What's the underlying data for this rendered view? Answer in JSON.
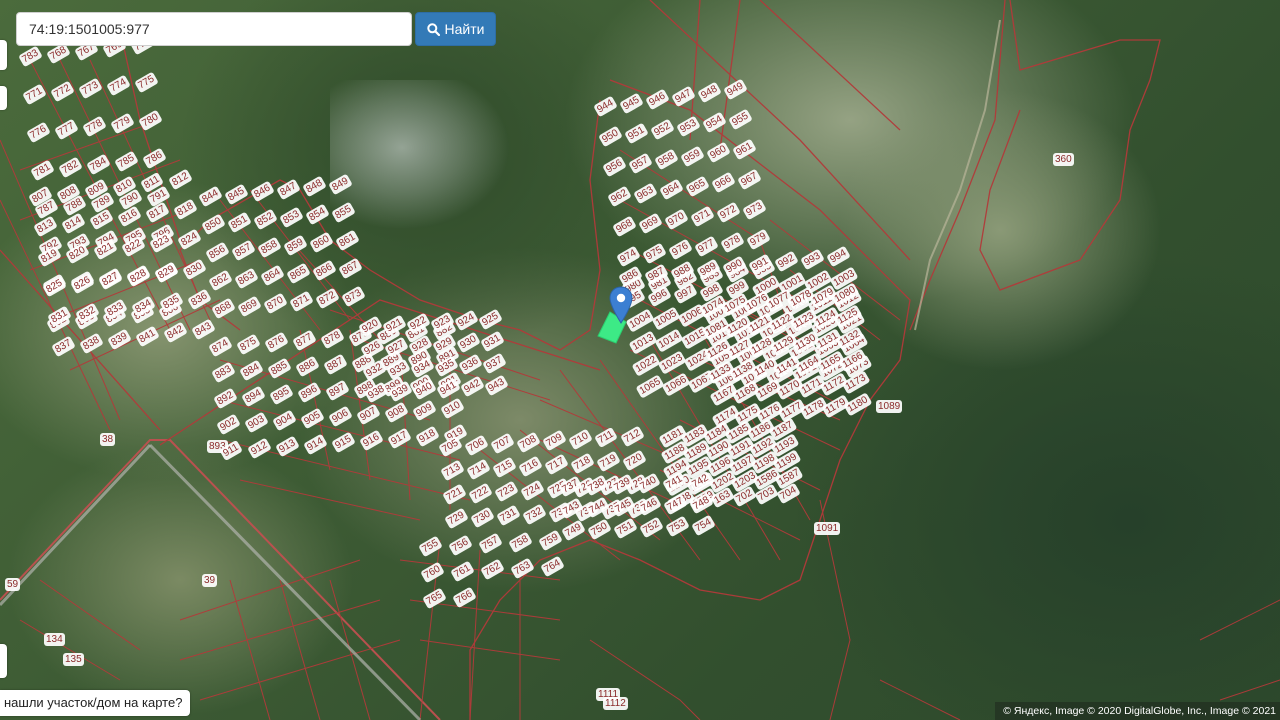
{
  "search": {
    "value": "74:19:1501005:977",
    "button_label": "Найти",
    "button_icon": "search-icon"
  },
  "feedback_tab": {
    "label": "нашли участок/дом на карте?"
  },
  "attribution": {
    "text": "© Яндекс, Image © 2020 DigitalGlobe, Inc., Image © 2021"
  },
  "marker": {
    "icon": "map-pin-icon",
    "color": "#3c7fd2"
  },
  "selected_parcel": {
    "color": "#3dea86"
  },
  "colors": {
    "parcel_border": "#b23a3a",
    "label_text": "#8b2a2a",
    "button": "#337ab7"
  },
  "parcel_labels": [
    "783",
    "768",
    "767",
    "769",
    "770",
    "771",
    "772",
    "773",
    "774",
    "775",
    "776",
    "777",
    "778",
    "779",
    "780",
    "781",
    "782",
    "784",
    "785",
    "786",
    "787",
    "788",
    "789",
    "790",
    "791",
    "792",
    "793",
    "794",
    "795",
    "796",
    "797",
    "798",
    "799",
    "800",
    "801",
    "802",
    "803",
    "804",
    "805",
    "806",
    "807",
    "808",
    "809",
    "810",
    "811",
    "812",
    "813",
    "814",
    "815",
    "816",
    "817",
    "818",
    "819",
    "820",
    "821",
    "822",
    "823",
    "824",
    "825",
    "826",
    "827",
    "828",
    "829",
    "830",
    "831",
    "832",
    "833",
    "834",
    "835",
    "836",
    "837",
    "838",
    "839",
    "841",
    "842",
    "843",
    "844",
    "845",
    "846",
    "847",
    "848",
    "849",
    "850",
    "851",
    "852",
    "853",
    "854",
    "855",
    "856",
    "857",
    "858",
    "859",
    "860",
    "861",
    "862",
    "863",
    "864",
    "865",
    "866",
    "867",
    "868",
    "869",
    "870",
    "871",
    "872",
    "873",
    "874",
    "875",
    "876",
    "877",
    "878",
    "879",
    "880",
    "881",
    "882",
    "883",
    "884",
    "885",
    "886",
    "887",
    "888",
    "889",
    "890",
    "891",
    "892",
    "893",
    "894",
    "895",
    "896",
    "897",
    "898",
    "899",
    "900",
    "901",
    "902",
    "903",
    "904",
    "905",
    "906",
    "907",
    "908",
    "909",
    "910",
    "911",
    "912",
    "913",
    "914",
    "915",
    "916",
    "917",
    "918",
    "919",
    "920",
    "921",
    "922",
    "923",
    "924",
    "925",
    "926",
    "927",
    "928",
    "929",
    "930",
    "931",
    "932",
    "933",
    "934",
    "935",
    "936",
    "937",
    "938",
    "939",
    "940",
    "941",
    "942",
    "943",
    "944",
    "945",
    "946",
    "947",
    "948",
    "949",
    "950",
    "951",
    "952",
    "953",
    "954",
    "955",
    "956",
    "957",
    "958",
    "959",
    "960",
    "961",
    "962",
    "963",
    "964",
    "965",
    "966",
    "967",
    "968",
    "969",
    "970",
    "971",
    "972",
    "973",
    "974",
    "975",
    "976",
    "977",
    "978",
    "979",
    "980",
    "981",
    "982",
    "983",
    "984",
    "985",
    "986",
    "987",
    "988",
    "989",
    "990",
    "991",
    "992",
    "993",
    "994",
    "995",
    "996",
    "997",
    "998",
    "999",
    "1000",
    "1001",
    "1002",
    "1003",
    "1004",
    "1005",
    "1006",
    "1007",
    "1008",
    "1009",
    "1010",
    "1011",
    "1012",
    "1013",
    "1014",
    "1015",
    "1016",
    "1017",
    "1018",
    "1019",
    "1020",
    "1021",
    "1022",
    "1023",
    "1024",
    "1059",
    "1060",
    "1061",
    "1062",
    "1063",
    "1064",
    "1065",
    "1066",
    "1067",
    "1068",
    "1069",
    "1070",
    "1071",
    "1072",
    "1073",
    "1074",
    "1075",
    "1076",
    "1077",
    "1078",
    "1079",
    "1080",
    "1081",
    "1089",
    "1091",
    "1111",
    "1112",
    "1120",
    "1121",
    "1122",
    "1123",
    "1124",
    "1125",
    "1126",
    "1127",
    "1128",
    "1129",
    "1130",
    "1131",
    "1132",
    "1133",
    "1138",
    "1140",
    "1141",
    "1164",
    "1165",
    "1166",
    "1167",
    "1168",
    "1169",
    "1170",
    "1171",
    "1172",
    "1173",
    "1174",
    "1175",
    "1176",
    "1177",
    "1178",
    "1179",
    "1180",
    "1181",
    "1183",
    "1184",
    "1185",
    "1186",
    "1187",
    "1188",
    "1189",
    "1190",
    "1191",
    "1192",
    "1193",
    "1194",
    "1195",
    "1196",
    "1197",
    "1198",
    "1199",
    "1200",
    "1201",
    "1202",
    "1203",
    "1586",
    "1587",
    "1588",
    "1589",
    "360",
    "38",
    "39",
    "59",
    "134",
    "135",
    "163",
    "702",
    "703",
    "704",
    "705",
    "706",
    "707",
    "708",
    "709",
    "710",
    "711",
    "712",
    "713",
    "714",
    "715",
    "716",
    "717",
    "718",
    "719",
    "720",
    "721",
    "722",
    "723",
    "724",
    "725",
    "726",
    "727",
    "728",
    "729",
    "730",
    "731",
    "732",
    "733",
    "734",
    "735",
    "736",
    "737",
    "738",
    "739",
    "740",
    "741",
    "742",
    "743",
    "744",
    "745",
    "746",
    "747",
    "748",
    "749",
    "750",
    "751",
    "752",
    "753",
    "754",
    "755",
    "756",
    "757",
    "758",
    "759",
    "760",
    "761",
    "762",
    "763",
    "764",
    "765",
    "766"
  ]
}
